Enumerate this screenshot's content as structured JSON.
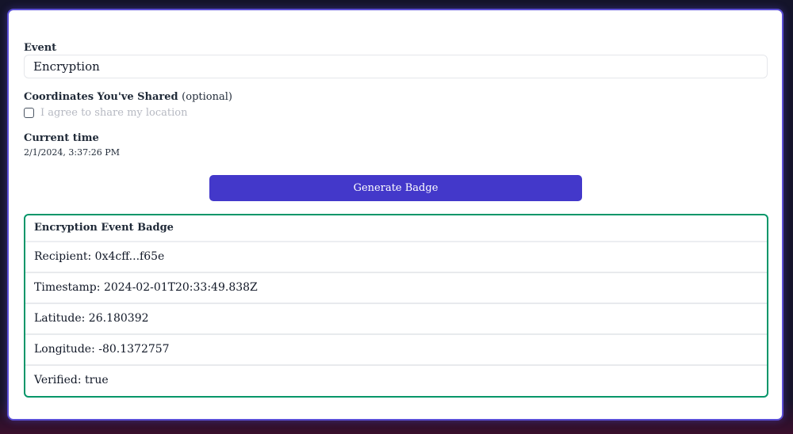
{
  "form": {
    "event_label": "Event",
    "event_value": "Encryption",
    "coords_label": "Coordinates You've Shared",
    "coords_optional": "(optional)",
    "share_location_text": "I agree to share my location",
    "time_label": "Current time",
    "time_value": "2/1/2024, 3:37:26 PM",
    "generate_label": "Generate Badge"
  },
  "badge": {
    "title": "Encryption Event Badge",
    "rows": [
      "Recipient: 0x4cff...f65e",
      "Timestamp: 2024-02-01T20:33:49.838Z",
      "Latitude: 26.180392",
      "Longitude: -80.1372757",
      "Verified: true"
    ]
  },
  "colors": {
    "accent": "#4338ca",
    "badge_border": "#059669",
    "card_border": "#5b4fd6"
  }
}
